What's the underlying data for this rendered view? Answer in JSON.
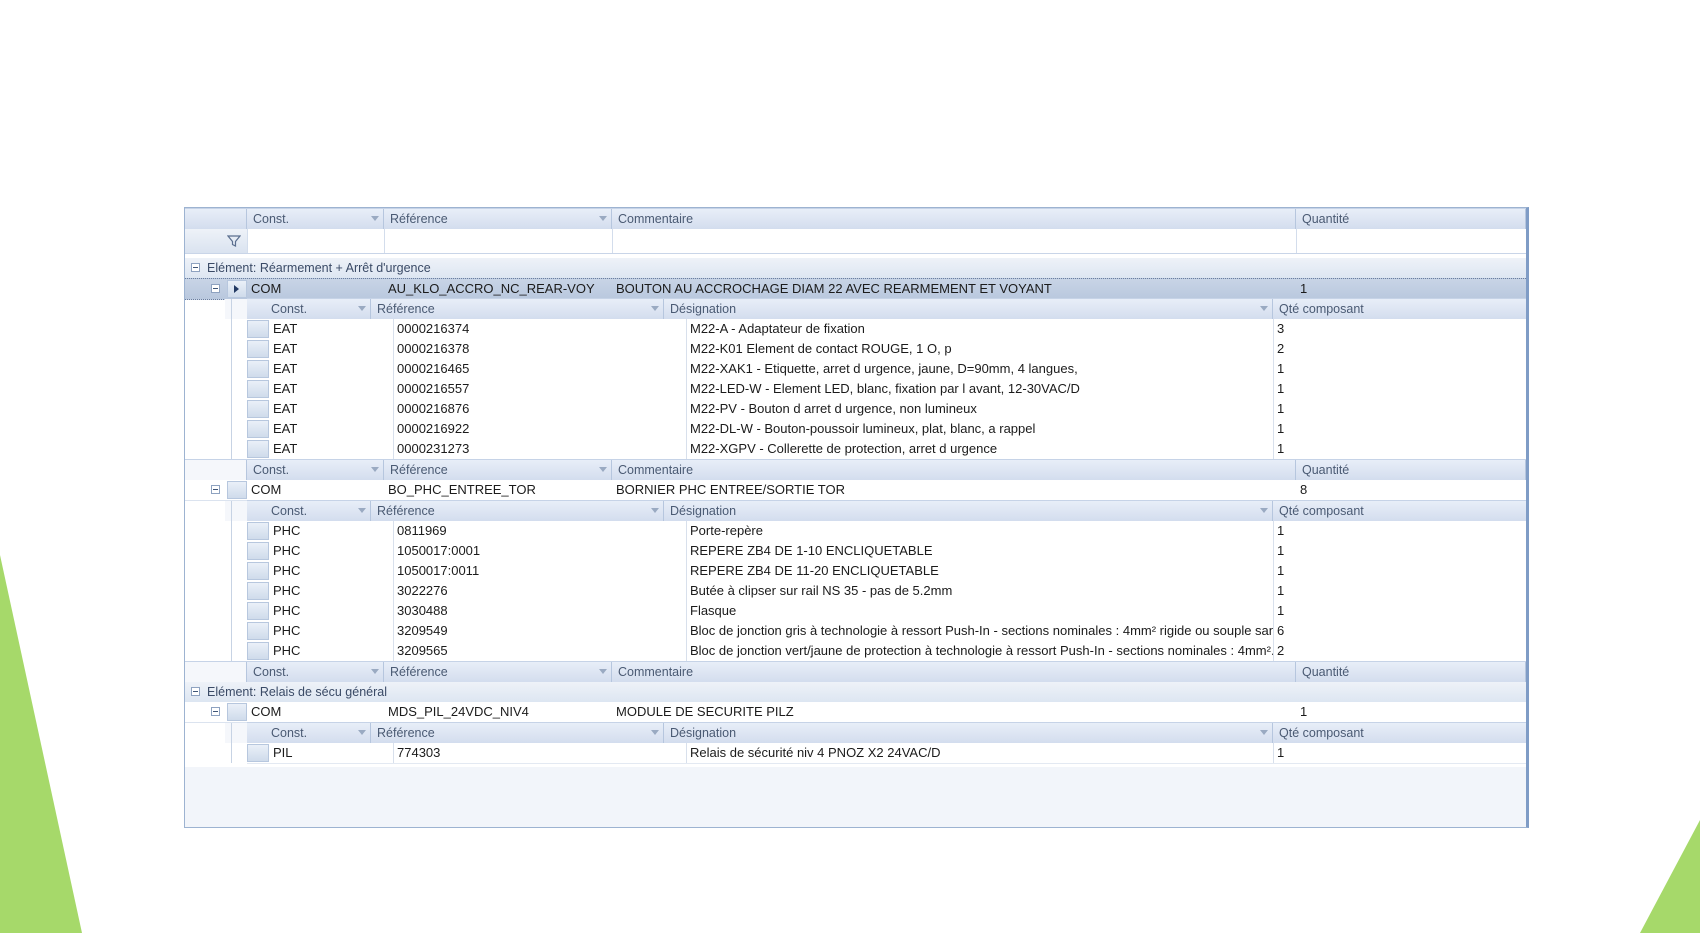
{
  "colors": {
    "accent": "#a6d96a",
    "header_bg": "#dbe4f1",
    "selected_row": "#bccadf",
    "border": "#9db3d1"
  },
  "top_header": {
    "const": "Const.",
    "reference": "Référence",
    "commentaire": "Commentaire",
    "quantite": "Quantité"
  },
  "detail_header": {
    "const": "Const.",
    "reference": "Référence",
    "designation": "Désignation",
    "qte_composant": "Qté composant"
  },
  "groups": [
    {
      "label": "Elément:",
      "value": "Réarmement + Arrêt d'urgence",
      "masters": [
        {
          "const": "COM",
          "reference": "AU_KLO_ACCRO_NC_REAR-VOY",
          "commentaire": "BOUTON AU ACCROCHAGE DIAM 22 AVEC REARMEMENT ET VOYANT",
          "quantite": "1",
          "components": [
            {
              "const": "EAT",
              "reference": "0000216374",
              "designation": "M22-A - Adaptateur de fixation",
              "qte": "3"
            },
            {
              "const": "EAT",
              "reference": "0000216378",
              "designation": "M22-K01 Element de contact ROUGE, 1 O, p",
              "qte": "2"
            },
            {
              "const": "EAT",
              "reference": "0000216465",
              "designation": "M22-XAK1 - Etiquette, arret d urgence, jaune, D=90mm, 4 langues,",
              "qte": "1"
            },
            {
              "const": "EAT",
              "reference": "0000216557",
              "designation": "M22-LED-W - Element LED, blanc, fixation par l avant, 12-30VAC/D",
              "qte": "1"
            },
            {
              "const": "EAT",
              "reference": "0000216876",
              "designation": "M22-PV - Bouton d arret d urgence, non lumineux",
              "qte": "1"
            },
            {
              "const": "EAT",
              "reference": "0000216922",
              "designation": "M22-DL-W - Bouton-poussoir lumineux, plat, blanc, a rappel",
              "qte": "1"
            },
            {
              "const": "EAT",
              "reference": "0000231273",
              "designation": "M22-XGPV - Collerette de protection, arret d urgence",
              "qte": "1"
            }
          ]
        },
        {
          "const": "COM",
          "reference": "BO_PHC_ENTREE_TOR",
          "commentaire": "BORNIER PHC ENTREE/SORTIE TOR",
          "quantite": "8",
          "components": [
            {
              "const": "PHC",
              "reference": "0811969",
              "designation": "Porte-repère",
              "qte": "1"
            },
            {
              "const": "PHC",
              "reference": "1050017:0001",
              "designation": "REPERE ZB4 DE 1-10 ENCLIQUETABLE",
              "qte": "1"
            },
            {
              "const": "PHC",
              "reference": "1050017:0011",
              "designation": "REPERE ZB4 DE 11-20 ENCLIQUETABLE",
              "qte": "1"
            },
            {
              "const": "PHC",
              "reference": "3022276",
              "designation": "Butée à clipser sur rail NS 35 - pas de 5.2mm",
              "qte": "1"
            },
            {
              "const": "PHC",
              "reference": "3030488",
              "designation": "Flasque",
              "qte": "1"
            },
            {
              "const": "PHC",
              "reference": "3209549",
              "designation": "Bloc de jonction gris à technologie à ressort Push-In - sections nominales : 4mm² rigide ou souple san.",
              "qte": "6"
            },
            {
              "const": "PHC",
              "reference": "3209565",
              "designation": "Bloc de jonction vert/jaune de protection à technologie à ressort Push-In - sections nominales : 4mm².",
              "qte": "2"
            }
          ]
        }
      ]
    },
    {
      "label": "Elément:",
      "value": "Relais de sécu général",
      "masters": [
        {
          "const": "COM",
          "reference": "MDS_PIL_24VDC_NIV4",
          "commentaire": "MODULE DE SECURITE PILZ",
          "quantite": "1",
          "components": [
            {
              "const": "PIL",
              "reference": "774303",
              "designation": "Relais de sécurité niv 4 PNOZ X2 24VAC/D",
              "qte": "1"
            }
          ]
        }
      ]
    }
  ]
}
